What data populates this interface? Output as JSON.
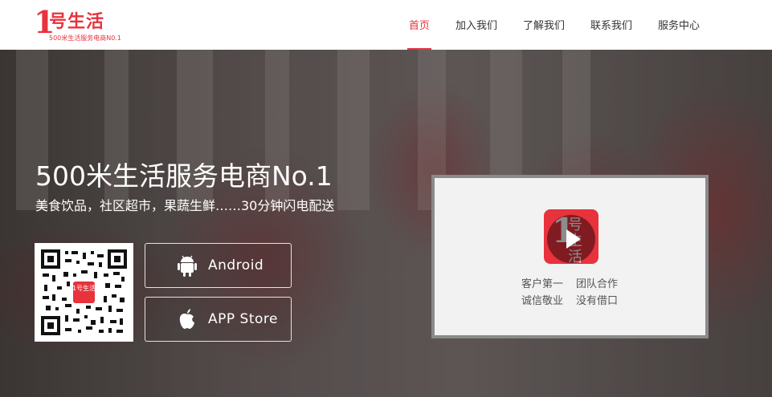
{
  "brand": {
    "logo_mark": "1",
    "logo_text": "号生活",
    "logo_tagline": "500米生活服务电商N0.1",
    "accent_color": "#e8323c"
  },
  "nav": {
    "items": [
      {
        "label": "首页",
        "active": true
      },
      {
        "label": "加入我们",
        "active": false
      },
      {
        "label": "了解我们",
        "active": false
      },
      {
        "label": "联系我们",
        "active": false
      },
      {
        "label": "服务中心",
        "active": false
      }
    ]
  },
  "hero": {
    "title": "500米生活服务电商No.1",
    "subtitle": "美食饮品，社区超市，果蔬生鲜……30分钟闪电配送",
    "qr_center_text": "1号生活",
    "buttons": {
      "android": {
        "label": "Android",
        "icon": "android-icon"
      },
      "appstore": {
        "label": "APP Store",
        "icon": "apple-icon"
      }
    }
  },
  "video": {
    "logo_mark": "1",
    "logo_text": "号生活",
    "play_icon": "play-icon",
    "slogans": [
      "客户第一",
      "团队合作",
      "诚信敬业",
      "没有借口"
    ]
  }
}
